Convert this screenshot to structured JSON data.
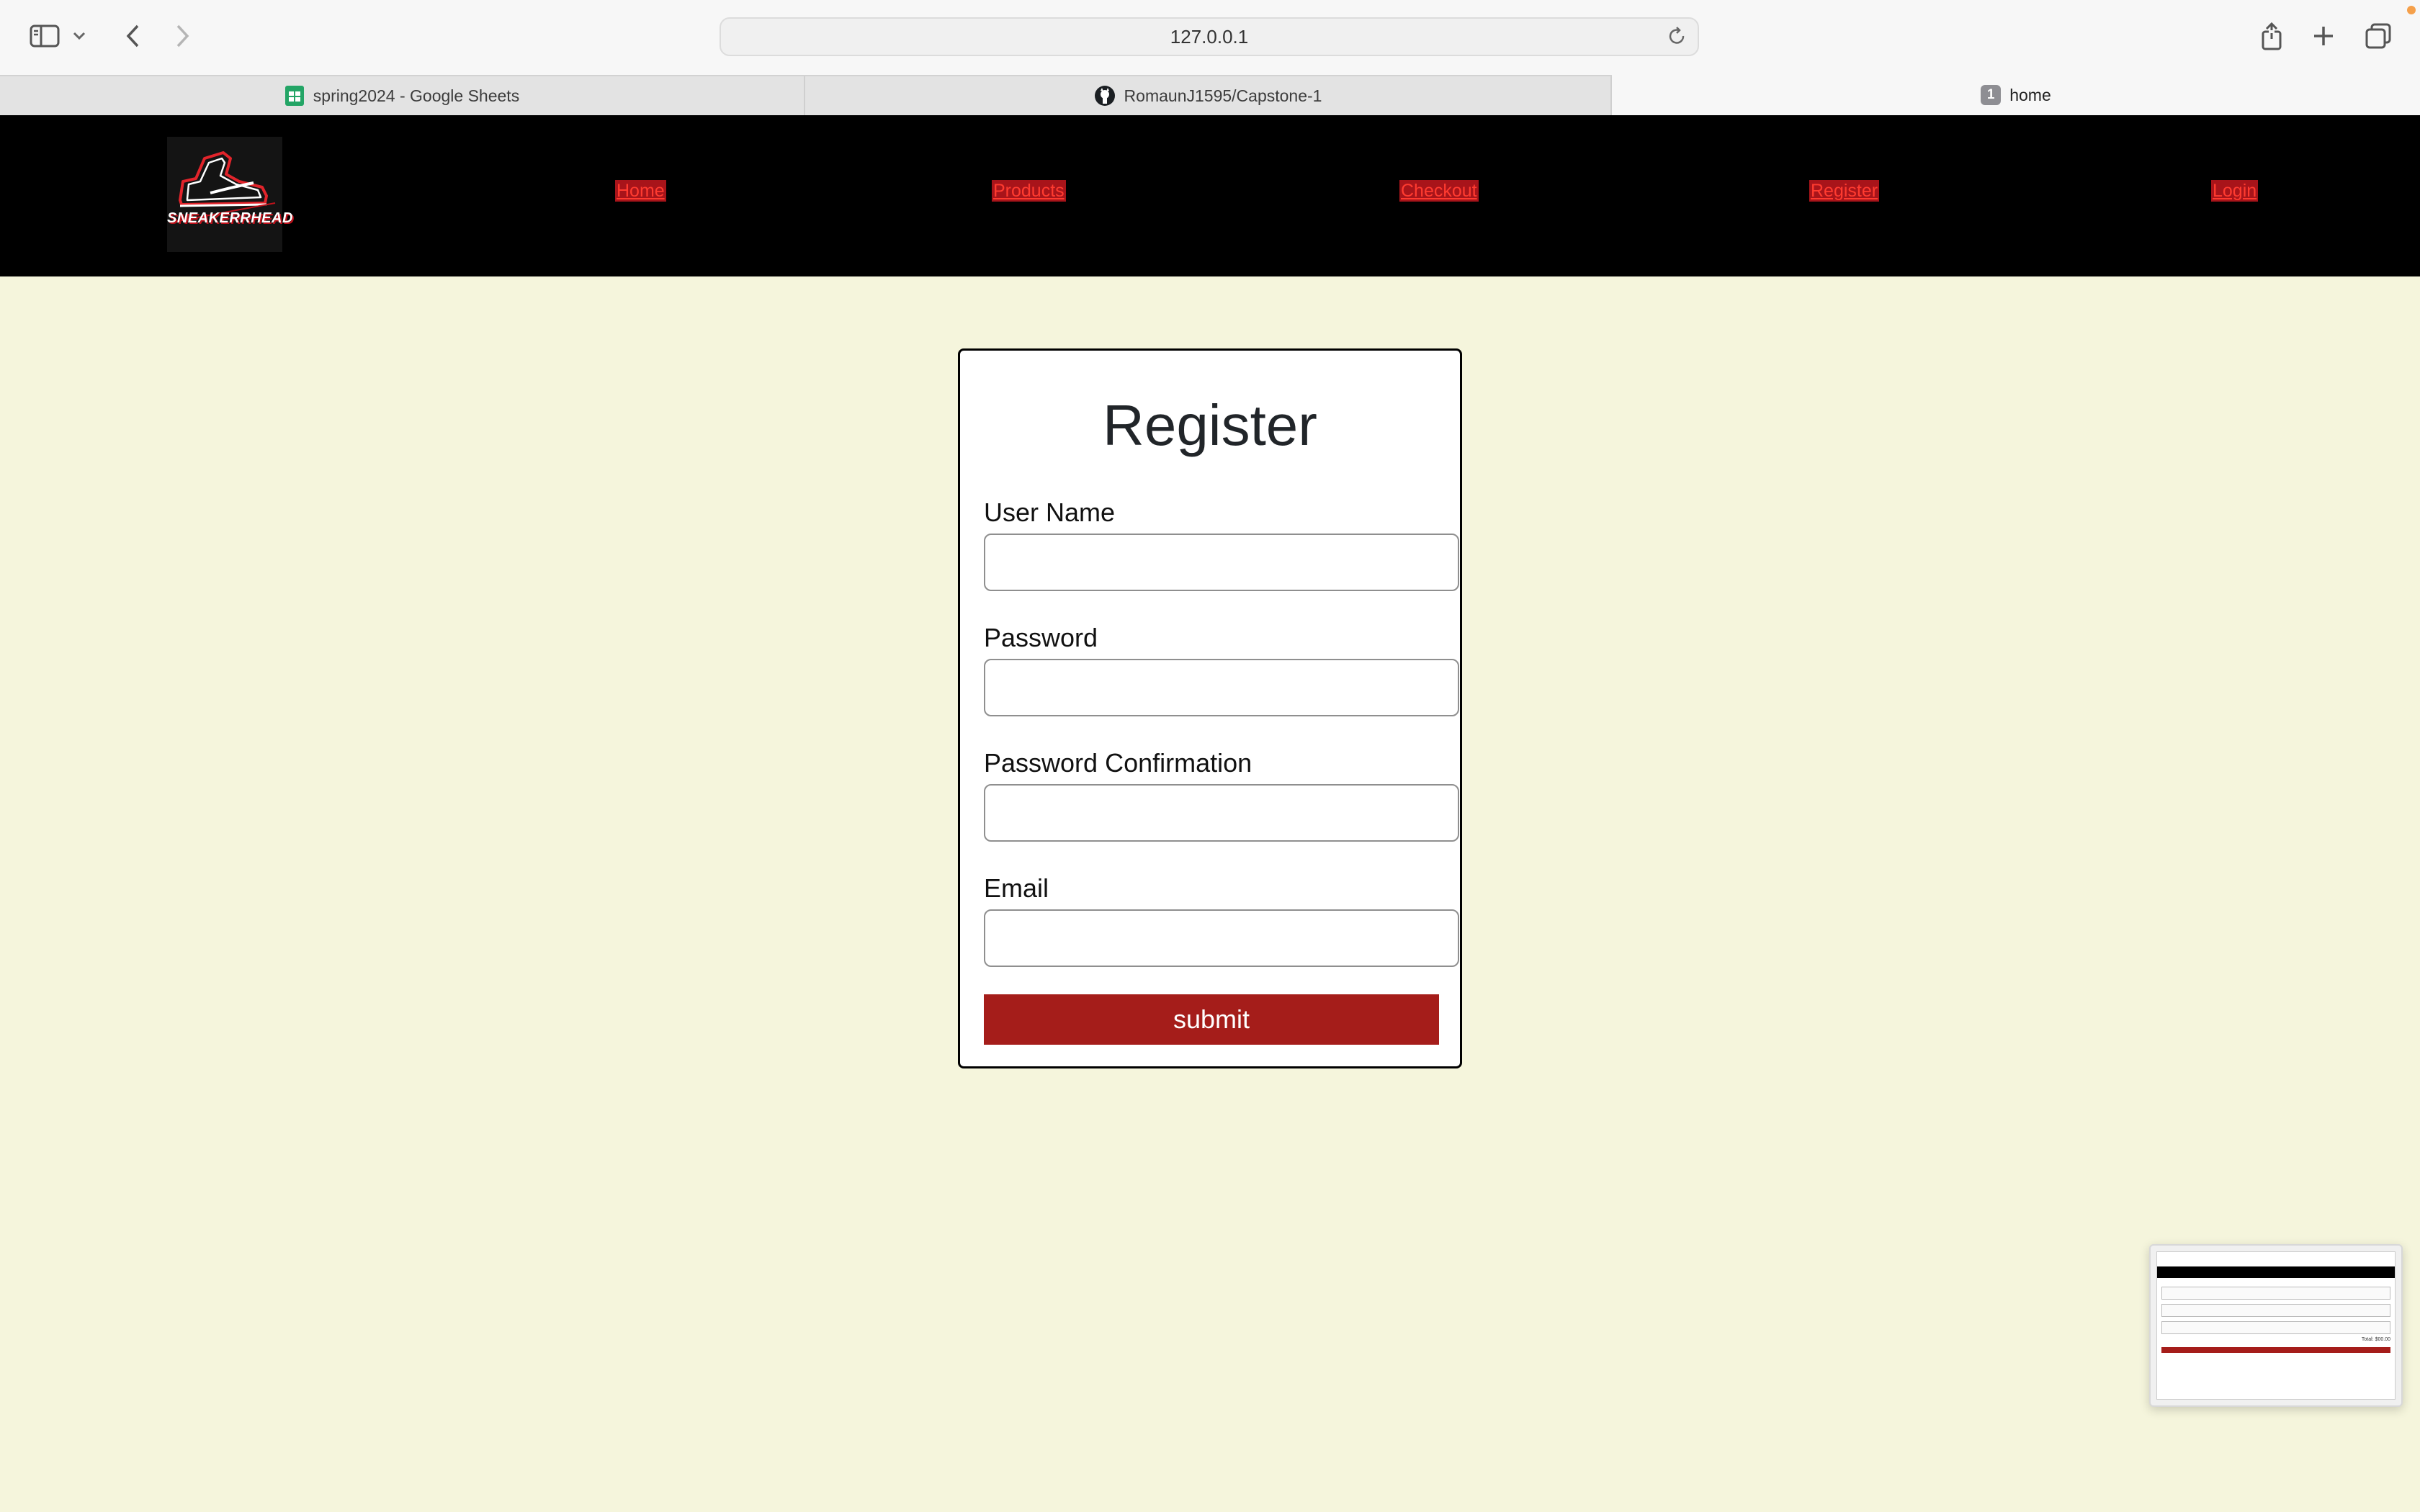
{
  "browser": {
    "url": "127.0.0.1",
    "tabs": [
      {
        "label": "spring2024 - Google Sheets",
        "icon": "google-sheets-icon"
      },
      {
        "label": "RomaunJ1595/Capstone-1",
        "icon": "github-icon"
      },
      {
        "label": "home",
        "badge": "1",
        "active": true
      }
    ]
  },
  "nav": {
    "logo_text": "SNEAKERRHEAD",
    "links": [
      "Home",
      "Products",
      "Checkout",
      "Register",
      "Login"
    ]
  },
  "form": {
    "title": "Register",
    "fields": [
      {
        "label": "User Name",
        "value": ""
      },
      {
        "label": "Password",
        "value": ""
      },
      {
        "label": "Password Confirmation",
        "value": ""
      },
      {
        "label": "Email",
        "value": ""
      }
    ],
    "submit_label": "submit"
  },
  "thumbnail": {
    "total_text": "Total: $00.00"
  },
  "colors": {
    "page_bg": "#f5f5dc",
    "nav_bg": "#000000",
    "accent": "#a51d1a",
    "nav_link_text": "#ff3b30"
  }
}
